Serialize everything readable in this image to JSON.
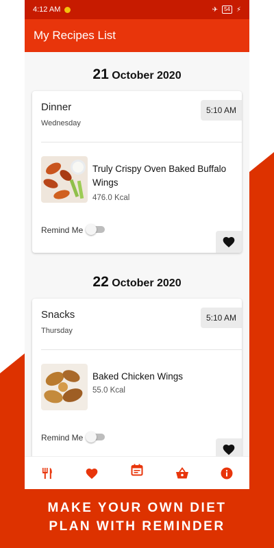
{
  "status_bar": {
    "time": "4:12 AM",
    "battery": "54"
  },
  "app_bar": {
    "title": "My Recipes List"
  },
  "groups": [
    {
      "date_day": "21",
      "date_rest": "October 2020",
      "entry": {
        "meal_type": "Dinner",
        "weekday": "Wednesday",
        "time": "5:10 AM",
        "recipe_name": "Truly Crispy Oven Baked Buffalo Wings",
        "kcal": "476.0 Kcal",
        "remind_label": "Remind Me",
        "remind_on": false,
        "favorite": true
      }
    },
    {
      "date_day": "22",
      "date_rest": "October 2020",
      "entry": {
        "meal_type": "Snacks",
        "weekday": "Thursday",
        "time": "5:10 AM",
        "recipe_name": "Baked Chicken Wings",
        "kcal": "55.0 Kcal",
        "remind_label": "Remind Me",
        "remind_on": false,
        "favorite": true
      }
    }
  ],
  "bottom_nav": {
    "items": [
      {
        "icon": "fork-knife-icon"
      },
      {
        "icon": "heart-icon"
      },
      {
        "icon": "calendar-icon",
        "active": true
      },
      {
        "icon": "basket-icon"
      },
      {
        "icon": "info-icon"
      }
    ],
    "accent_color": "#e8350b"
  },
  "promo": {
    "line1": "MAKE YOUR OWN DIET",
    "line2": "PLAN WITH REMINDER"
  },
  "colors": {
    "brand": "#e8350b",
    "status_bar": "#c71b00",
    "background_accent": "#dd3200"
  }
}
